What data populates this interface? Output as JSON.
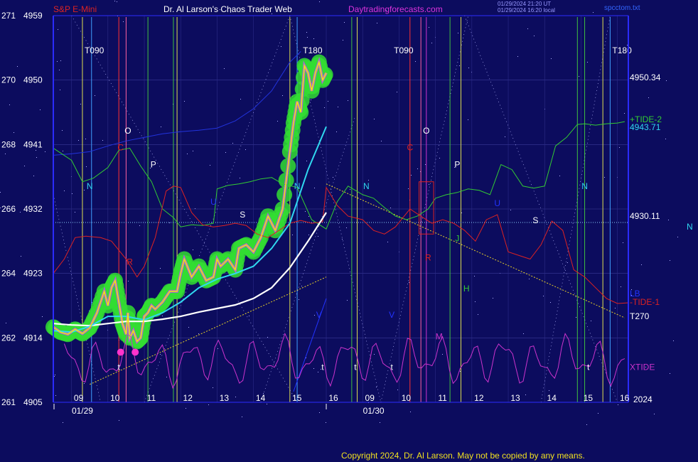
{
  "header": {
    "instrument": "S&P E-Mini",
    "author": "Dr. Al Larson's Chaos Trader Web",
    "site": "Daytradingforecasts.com",
    "stamp_line1": "01/29/2024 21:20 UT",
    "stamp_line2": "01/29/2024 16:20 local",
    "file": "spcctom.txt"
  },
  "copyright": "Copyright 2024, Dr. Al Larson. May not be copied by any means.",
  "colors": {
    "background": "#0c0c5e",
    "price": "#f0f000",
    "glow": "#33dd33",
    "ema_fast": "#30d8f0",
    "ema_slow": "#ffffff",
    "tide2": "#33cc33",
    "tide1": "#dd2222",
    "xtide": "#cc33cc",
    "blue_line": "#2233dd",
    "axis": "#2b2bff"
  },
  "chart_data": {
    "type": "line",
    "title": "S&P E-Mini",
    "ylim": [
      4905,
      4959
    ],
    "y_ticks": [
      {
        "left": "271",
        "right": "4959",
        "value": 4959
      },
      {
        "left": "270",
        "right": "4950",
        "value": 4950
      },
      {
        "left": "268",
        "right": "4941",
        "value": 4941
      },
      {
        "left": "266",
        "right": "4932",
        "value": 4932
      },
      {
        "left": "264",
        "right": "4923",
        "value": 4923
      },
      {
        "left": "262",
        "right": "4914",
        "value": 4914
      },
      {
        "left": "261",
        "right": "4905",
        "value": 4905
      }
    ],
    "xlim": [
      8.5,
      24.3
    ],
    "x_ticks": [
      {
        "label": "09",
        "x": 9
      },
      {
        "label": "10",
        "x": 10
      },
      {
        "label": "11",
        "x": 11
      },
      {
        "label": "12",
        "x": 12
      },
      {
        "label": "13",
        "x": 13
      },
      {
        "label": "14",
        "x": 14
      },
      {
        "label": "15",
        "x": 15
      },
      {
        "label": "16",
        "x": 16
      },
      {
        "label": "09",
        "x": 17
      },
      {
        "label": "10",
        "x": 18
      },
      {
        "label": "11",
        "x": 19
      },
      {
        "label": "12",
        "x": 20
      },
      {
        "label": "13",
        "x": 21
      },
      {
        "label": "14",
        "x": 22
      },
      {
        "label": "15",
        "x": 23
      },
      {
        "label": "16",
        "x": 24
      }
    ],
    "dates": [
      {
        "label": "01/29",
        "x": 9.3
      },
      {
        "label": "01/30",
        "x": 17.3
      }
    ],
    "year_label": "2024",
    "timing_labels": [
      {
        "text": "T090",
        "x": 9.3
      },
      {
        "text": "T180",
        "x": 15.3
      },
      {
        "text": "T090",
        "x": 17.8
      },
      {
        "text": "T180",
        "x": 23.8
      }
    ],
    "price_series": {
      "name": "S&P E-Mini",
      "x": [
        8.5,
        8.7,
        8.9,
        9.1,
        9.3,
        9.5,
        9.7,
        9.9,
        10.0,
        10.1,
        10.2,
        10.3,
        10.4,
        10.5,
        10.55,
        10.6,
        10.7,
        10.8,
        10.9,
        11.0,
        11.1,
        11.2,
        11.3,
        11.5,
        11.7,
        11.9,
        12.0,
        12.1,
        12.3,
        12.5,
        12.7,
        12.9,
        13.0,
        13.1,
        13.3,
        13.5,
        13.6,
        13.8,
        14.0,
        14.2,
        14.4,
        14.6,
        14.8,
        15.0,
        15.1,
        15.2,
        15.3,
        15.4,
        15.5,
        15.6,
        15.7,
        15.8,
        15.9,
        16.0
      ],
      "values": [
        4915.5,
        4914.8,
        4914.5,
        4915.2,
        4914.6,
        4915.4,
        4917.5,
        4920.5,
        4918.5,
        4921.0,
        4922.0,
        4919.0,
        4916.0,
        4914.5,
        4917.5,
        4914.0,
        4915.0,
        4913.5,
        4914.0,
        4917.0,
        4917.5,
        4918.5,
        4918.0,
        4919.0,
        4920.5,
        4920.5,
        4923.0,
        4925.0,
        4922.5,
        4924.0,
        4922.0,
        4922.5,
        4925.0,
        4924.0,
        4925.0,
        4923.5,
        4926.5,
        4927.0,
        4926.0,
        4928.0,
        4931.0,
        4929.0,
        4932.0,
        4940.0,
        4944.0,
        4947.0,
        4945.5,
        4952.0,
        4951.0,
        4948.5,
        4951.0,
        4952.5,
        4950.0,
        4951.0
      ]
    },
    "ema_fast": {
      "x": [
        8.5,
        9.0,
        9.5,
        10.0,
        10.5,
        11.0,
        11.5,
        12.0,
        12.5,
        13.0,
        13.5,
        14.0,
        14.5,
        15.0,
        15.5,
        16.0
      ],
      "values": [
        4915.0,
        4914.8,
        4915.6,
        4917.0,
        4917.0,
        4916.5,
        4917.5,
        4919.0,
        4921.0,
        4922.2,
        4923.0,
        4924.0,
        4926.5,
        4930.0,
        4937.5,
        4943.5
      ]
    },
    "ema_slow": {
      "x": [
        8.5,
        9.0,
        9.5,
        10.0,
        10.5,
        11.0,
        11.5,
        12.0,
        12.5,
        13.0,
        13.5,
        14.0,
        14.5,
        15.0,
        15.5,
        16.0
      ],
      "values": [
        4916.0,
        4915.8,
        4915.7,
        4916.0,
        4916.3,
        4916.3,
        4916.6,
        4917.0,
        4917.6,
        4918.1,
        4918.6,
        4919.5,
        4921.0,
        4923.8,
        4927.5,
        4931.5
      ]
    },
    "tide2": {
      "name": "+TIDE-2",
      "x": [
        8.5,
        9.0,
        9.3,
        9.6,
        10.0,
        10.3,
        10.6,
        10.9,
        11.2,
        11.5,
        11.8,
        12.0,
        12.3,
        12.6,
        12.9,
        13.0,
        13.3,
        13.6,
        13.9,
        14.2,
        14.5,
        14.8,
        15.2,
        15.6,
        16.0,
        16.3,
        16.6,
        17.0,
        17.3,
        17.6,
        17.9,
        18.2,
        18.5,
        18.8,
        19.0,
        19.3,
        19.6,
        19.9,
        20.2,
        20.5,
        20.8,
        21.1,
        21.4,
        21.7,
        22.0,
        22.3,
        22.6,
        22.9,
        23.1,
        23.4,
        23.7,
        24.0,
        24.2
      ],
      "values": [
        4940.5,
        4938.8,
        4935.8,
        4936.3,
        4937.8,
        4940.2,
        4940.5,
        4938.0,
        4935.8,
        4932.0,
        4930.8,
        4929.5,
        4929.8,
        4929.7,
        4930.0,
        4934.8,
        4935.3,
        4935.5,
        4935.8,
        4936.2,
        4936.4,
        4935.5,
        4935.0,
        4930.5,
        4929.2,
        4933.0,
        4935.2,
        4934.0,
        4933.5,
        4932.2,
        4931.0,
        4930.5,
        4931.0,
        4932.0,
        4933.5,
        4934.0,
        4934.3,
        4934.8,
        4934.6,
        4934.0,
        4938.2,
        4937.5,
        4935.2,
        4934.9,
        4935.2,
        4940.8,
        4942.0,
        4943.8,
        4943.9,
        4943.7,
        4943.9,
        4944.0,
        4944.2
      ]
    },
    "tide1": {
      "name": "-TIDE-1",
      "x": [
        8.5,
        8.8,
        9.1,
        9.4,
        9.8,
        10.1,
        10.5,
        10.8,
        11.0,
        11.3,
        11.6,
        11.8,
        12.0,
        12.3,
        12.6,
        12.9,
        13.2,
        13.5,
        13.8,
        14.1,
        14.4,
        14.7,
        15.0,
        15.3,
        15.6,
        15.9,
        16.0,
        16.3,
        16.6,
        17.0,
        17.3,
        17.6,
        17.9,
        18.3,
        18.6,
        18.9,
        19.2,
        19.5,
        19.8,
        20.1,
        20.4,
        20.7,
        21.0,
        21.3,
        21.6,
        21.9,
        22.2,
        22.5,
        22.8,
        23.1,
        23.4,
        23.7,
        24.0,
        24.3
      ],
      "values": [
        4923.0,
        4925.0,
        4928.0,
        4928.2,
        4928.0,
        4927.5,
        4925.0,
        4922.5,
        4924.0,
        4928.0,
        4934.5,
        4935.2,
        4935.0,
        4931.5,
        4929.8,
        4929.5,
        4929.7,
        4930.0,
        4929.7,
        4928.5,
        4928.0,
        4929.0,
        4930.0,
        4930.4,
        4930.0,
        4930.2,
        4935.0,
        4932.5,
        4931.0,
        4930.5,
        4929.0,
        4928.5,
        4929.5,
        4932.0,
        4931.0,
        4930.0,
        4930.5,
        4930.0,
        4929.0,
        4927.5,
        4930.5,
        4931.2,
        4926.0,
        4925.5,
        4925.0,
        4927.0,
        4930.3,
        4929.0,
        4923.5,
        4922.5,
        4921.0,
        4919.5,
        4918.8,
        4918.9
      ]
    },
    "blue_line": {
      "x": [
        8.5,
        9.0,
        9.5,
        10.0,
        10.5,
        11.0,
        11.5,
        12.0,
        12.5,
        13.0,
        13.5,
        14.0,
        14.5,
        15.0,
        15.3
      ],
      "values": [
        4939.5,
        4939.7,
        4940.0,
        4940.8,
        4941.5,
        4942.0,
        4942.5,
        4942.8,
        4943.0,
        4943.3,
        4944.3,
        4946.0,
        4948.5,
        4952.5,
        4954.0
      ]
    },
    "xtide": {
      "name": "XTIDE",
      "y_low": 4906.8,
      "y_high": 4914.8,
      "points": 160,
      "x_start": 8.8,
      "x_end": 24.2
    },
    "reference_lines": [
      {
        "label": "4930.11",
        "value": 4930.11,
        "style": "dotted"
      },
      {
        "label": "4950.34",
        "value": 4950.34,
        "style": "label"
      },
      {
        "label": "4943.71",
        "value": 4943.71,
        "style": "label"
      }
    ],
    "trend_lines": [
      {
        "x": [
          9.5,
          16.0
        ],
        "y": [
          4907.5,
          4922.5
        ],
        "color": "#e8d028",
        "style": "dotted"
      },
      {
        "x": [
          16.0,
          24.2
        ],
        "y": [
          4935.5,
          4916.8
        ],
        "color": "#e8d028",
        "style": "dotted"
      },
      {
        "x": [
          15.1,
          16.0
        ],
        "y": [
          4906.5,
          4919.5
        ],
        "color": "#2233ff",
        "style": "solid"
      }
    ],
    "vertical_lines": [
      {
        "x": 9.3,
        "color": "#e0e050"
      },
      {
        "x": 9.55,
        "color": "#40a0ff"
      },
      {
        "x": 10.3,
        "color": "#ff3030"
      },
      {
        "x": 10.5,
        "color": "#ff60a0"
      },
      {
        "x": 11.1,
        "color": "#40c040"
      },
      {
        "x": 11.8,
        "color": "#40c040"
      },
      {
        "x": 11.9,
        "color": "#e0e050"
      },
      {
        "x": 15.0,
        "color": "#e0e050"
      },
      {
        "x": 15.2,
        "color": "#40a0ff"
      },
      {
        "x": 16.7,
        "color": "#40c040"
      },
      {
        "x": 16.85,
        "color": "#e0e050"
      },
      {
        "x": 18.3,
        "color": "#ff3030"
      },
      {
        "x": 18.6,
        "color": "#ff60a0"
      },
      {
        "x": 18.75,
        "color": "#cc33cc"
      },
      {
        "x": 19.4,
        "color": "#40c040"
      },
      {
        "x": 19.7,
        "color": "#e0e050"
      },
      {
        "x": 22.9,
        "color": "#40c040"
      },
      {
        "x": 23.1,
        "color": "#40c040"
      },
      {
        "x": 23.6,
        "color": "#e0e050"
      },
      {
        "x": 23.8,
        "color": "#40a0ff"
      }
    ],
    "annotations": [
      {
        "text": "O",
        "x": 10.55,
        "y": 4942.5,
        "color": "#ffffff"
      },
      {
        "text": "C",
        "x": 10.35,
        "y": 4940.2,
        "color": "#dd2222"
      },
      {
        "text": "P",
        "x": 11.25,
        "y": 4937.8,
        "color": "#ffffff"
      },
      {
        "text": "N",
        "x": 9.5,
        "y": 4934.8,
        "color": "#30d8f0"
      },
      {
        "text": "R",
        "x": 10.6,
        "y": 4924.2,
        "color": "#dd2222"
      },
      {
        "text": "U",
        "x": 12.9,
        "y": 4932.6,
        "color": "#2233ff"
      },
      {
        "text": "S",
        "x": 13.7,
        "y": 4930.8,
        "color": "#ffffff"
      },
      {
        "text": "N",
        "x": 15.2,
        "y": 4934.8,
        "color": "#30d8f0"
      },
      {
        "text": "V",
        "x": 15.8,
        "y": 4916.8,
        "color": "#2233ff"
      },
      {
        "text": "N",
        "x": 17.1,
        "y": 4934.8,
        "color": "#30d8f0"
      },
      {
        "text": "O",
        "x": 18.75,
        "y": 4942.5,
        "color": "#ffffff"
      },
      {
        "text": "C",
        "x": 18.3,
        "y": 4940.2,
        "color": "#dd2222"
      },
      {
        "text": "P",
        "x": 19.6,
        "y": 4937.8,
        "color": "#ffffff"
      },
      {
        "text": "V",
        "x": 17.8,
        "y": 4916.8,
        "color": "#2233ff"
      },
      {
        "text": "R",
        "x": 18.8,
        "y": 4924.8,
        "color": "#dd2222"
      },
      {
        "text": "M",
        "x": 19.1,
        "y": 4913.8,
        "color": "#cc33cc"
      },
      {
        "text": "U",
        "x": 20.7,
        "y": 4932.4,
        "color": "#2233ff"
      },
      {
        "text": "J",
        "x": 19.6,
        "y": 4927.5,
        "color": "#33cc33"
      },
      {
        "text": "H",
        "x": 19.85,
        "y": 4920.5,
        "color": "#33cc33"
      },
      {
        "text": "S",
        "x": 21.75,
        "y": 4930.0,
        "color": "#ffffff"
      },
      {
        "text": "N",
        "x": 23.1,
        "y": 4934.8,
        "color": "#30d8f0"
      },
      {
        "text": "t",
        "x": 10.3,
        "y": 4909.5,
        "color": "#ffffff"
      },
      {
        "text": "t",
        "x": 15.9,
        "y": 4909.5,
        "color": "#ffffff"
      },
      {
        "text": "t",
        "x": 16.8,
        "y": 4909.5,
        "color": "#ffffff"
      },
      {
        "text": "t",
        "x": 17.8,
        "y": 4909.5,
        "color": "#ffffff"
      },
      {
        "text": "t",
        "x": 23.2,
        "y": 4909.5,
        "color": "#ffffff"
      }
    ],
    "right_labels": [
      {
        "text": "4950.34",
        "y": 4950.34,
        "color": "#ffffff"
      },
      {
        "text": "+TIDE-2",
        "y": 4944.5,
        "color": "#33cc33"
      },
      {
        "text": "4943.71",
        "y": 4943.4,
        "color": "#30d8f0"
      },
      {
        "text": "4930.11",
        "y": 4931.0,
        "color": "#ffffff"
      },
      {
        "text": "N",
        "y": 4929.5,
        "color": "#30d8f0",
        "offset": 80
      },
      {
        "text": "LB",
        "y": 4920.2,
        "color": "#2233ff"
      },
      {
        "text": "-TIDE-1",
        "y": 4919.0,
        "color": "#dd2222"
      },
      {
        "text": "T270",
        "y": 4917.0,
        "color": "#ffffff"
      },
      {
        "text": "XTIDE",
        "y": 4909.9,
        "color": "#cc33cc"
      }
    ],
    "pivots": [
      {
        "x": 10.35,
        "y": 4912.0,
        "color": "#ff33cc"
      },
      {
        "x": 10.75,
        "y": 4912.0,
        "color": "#ff33cc"
      }
    ],
    "grid": true
  }
}
